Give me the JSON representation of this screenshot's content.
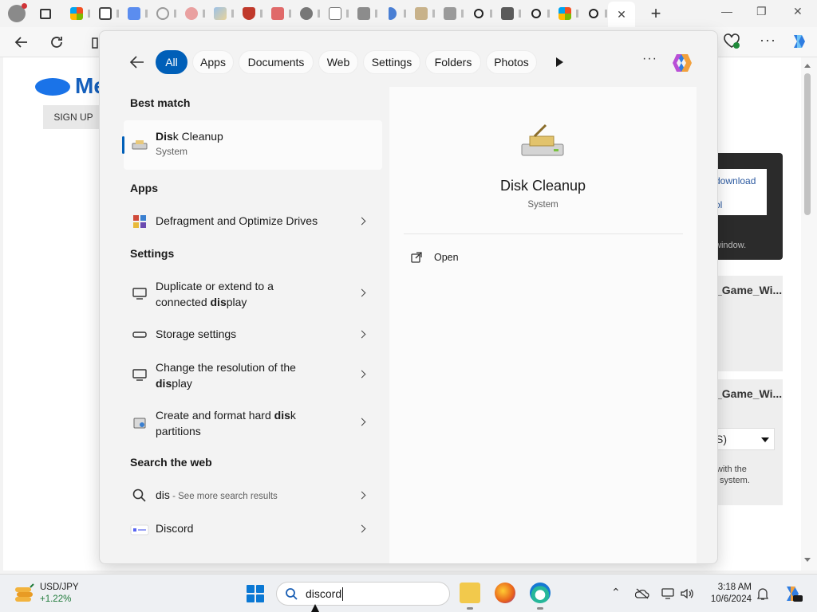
{
  "browser": {
    "toolbar_icons": [
      "back-icon",
      "refresh-icon",
      "home-icon",
      "extension-icon",
      "more-icon",
      "copilot-icon"
    ]
  },
  "page": {
    "logo_text": "Me",
    "signup_label": "SIGN UP",
    "download_link": "download",
    "tool_link": "ol",
    "window_note": "window.",
    "game_title_1": "_Game_Wi...",
    "game_title_2": "_Game_Wi...",
    "select_value": "S)",
    "note_line_1": "with the",
    "note_line_2": "system."
  },
  "search": {
    "filters": [
      {
        "label": "All",
        "active": true
      },
      {
        "label": "Apps",
        "active": false
      },
      {
        "label": "Documents",
        "active": false
      },
      {
        "label": "Web",
        "active": false
      },
      {
        "label": "Settings",
        "active": false
      },
      {
        "label": "Folders",
        "active": false
      },
      {
        "label": "Photos",
        "active": false
      }
    ],
    "best_match": {
      "heading": "Best match",
      "title_bold": "Dis",
      "title_rest": "k Cleanup",
      "subtitle": "System"
    },
    "apps": {
      "heading": "Apps",
      "items": [
        {
          "label": "Defragment and Optimize Drives"
        }
      ]
    },
    "settings": {
      "heading": "Settings",
      "items": [
        {
          "line1": "Duplicate or extend to a",
          "line2_pre": "connected ",
          "line2_bold": "dis",
          "line2_post": "play"
        },
        {
          "line1": "Storage settings"
        },
        {
          "line1": "Change the resolution of the",
          "line2_pre": "",
          "line2_bold": "dis",
          "line2_post": "play"
        },
        {
          "line1_pre": "Create and format hard ",
          "line1_bold": "dis",
          "line1_post": "k",
          "line2": "partitions"
        }
      ]
    },
    "web": {
      "heading": "Search the web",
      "query": "dis",
      "hint": " - See more search results",
      "suggestion": "Discord"
    },
    "detail": {
      "title": "Disk Cleanup",
      "subtitle": "System",
      "action": "Open"
    }
  },
  "taskbar": {
    "widget_title": "USD/JPY",
    "widget_change": "+1.22%",
    "search_value": "discord",
    "time": "3:18 AM",
    "date": "10/6/2024"
  }
}
